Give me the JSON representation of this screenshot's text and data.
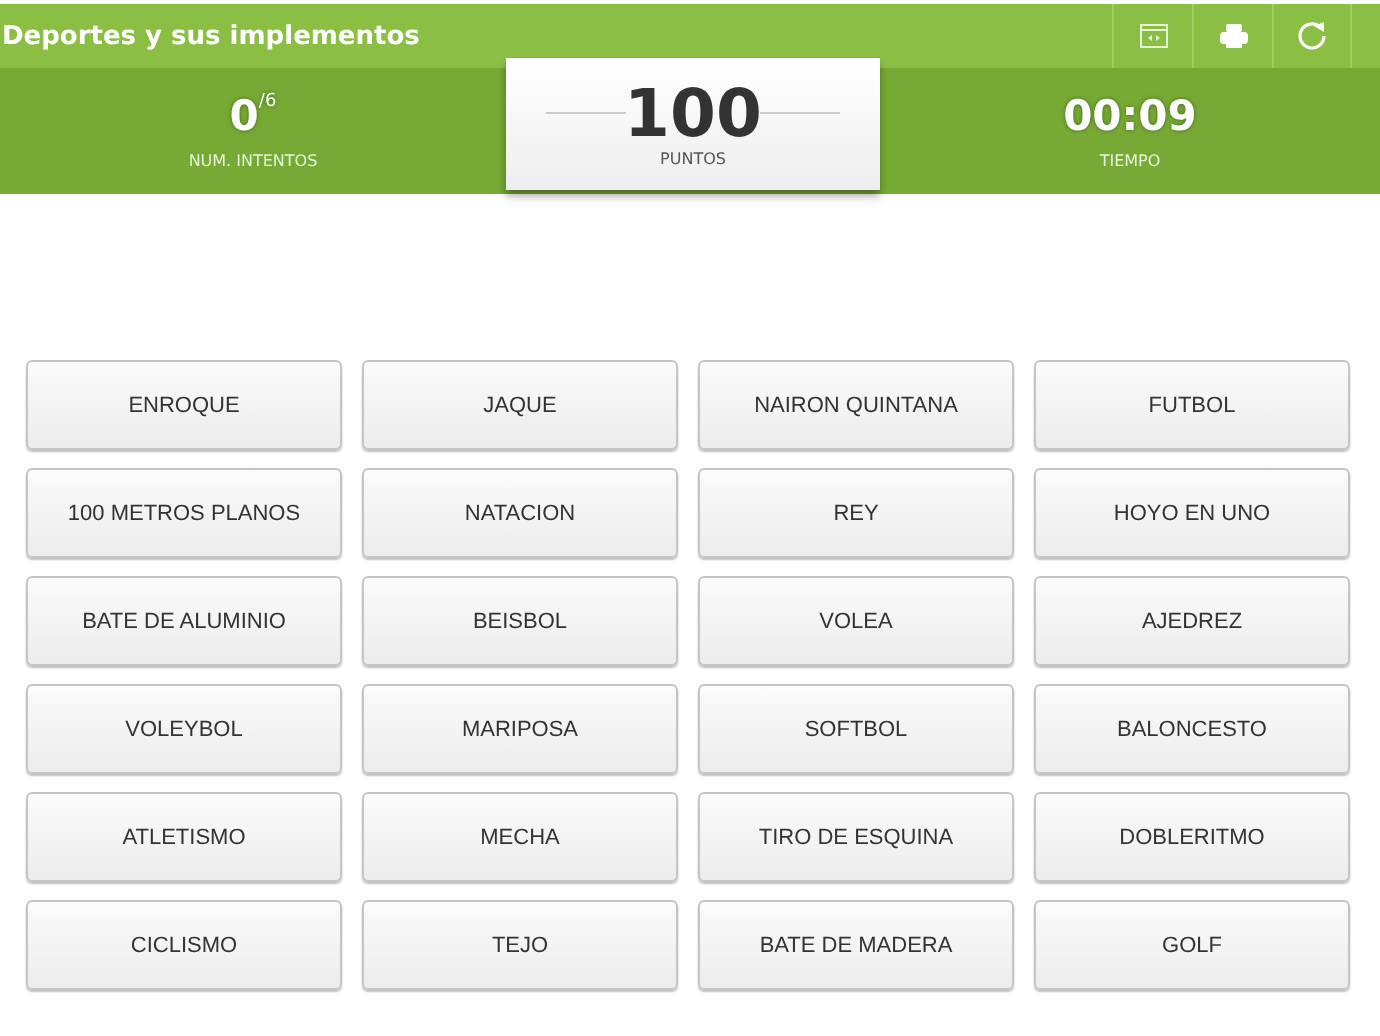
{
  "title": "Deportes y sus implementos",
  "toolbar": [
    {
      "kind": "fullscreen"
    },
    {
      "kind": "print"
    },
    {
      "kind": "restart"
    }
  ],
  "attempts": {
    "value": "0",
    "total": "/6",
    "label": "NUM. INTENTOS"
  },
  "score": {
    "value": "100",
    "label": "PUNTOS"
  },
  "time": {
    "value": "00:09",
    "label": "TIEMPO"
  },
  "tiles": [
    "ENROQUE",
    "JAQUE",
    "NAIRON QUINTANA",
    "FUTBOL",
    "100 METROS PLANOS",
    "NATACION",
    "REY",
    "HOYO EN UNO",
    "BATE DE ALUMINIO",
    "BEISBOL",
    "VOLEA",
    "AJEDREZ",
    "VOLEYBOL",
    "MARIPOSA",
    "SOFTBOL",
    "BALONCESTO",
    "ATLETISMO",
    "MECHA",
    "TIRO DE ESQUINA",
    "DOBLERITMO",
    "CICLISMO",
    "TEJO",
    "BATE DE MADERA",
    "GOLF"
  ]
}
